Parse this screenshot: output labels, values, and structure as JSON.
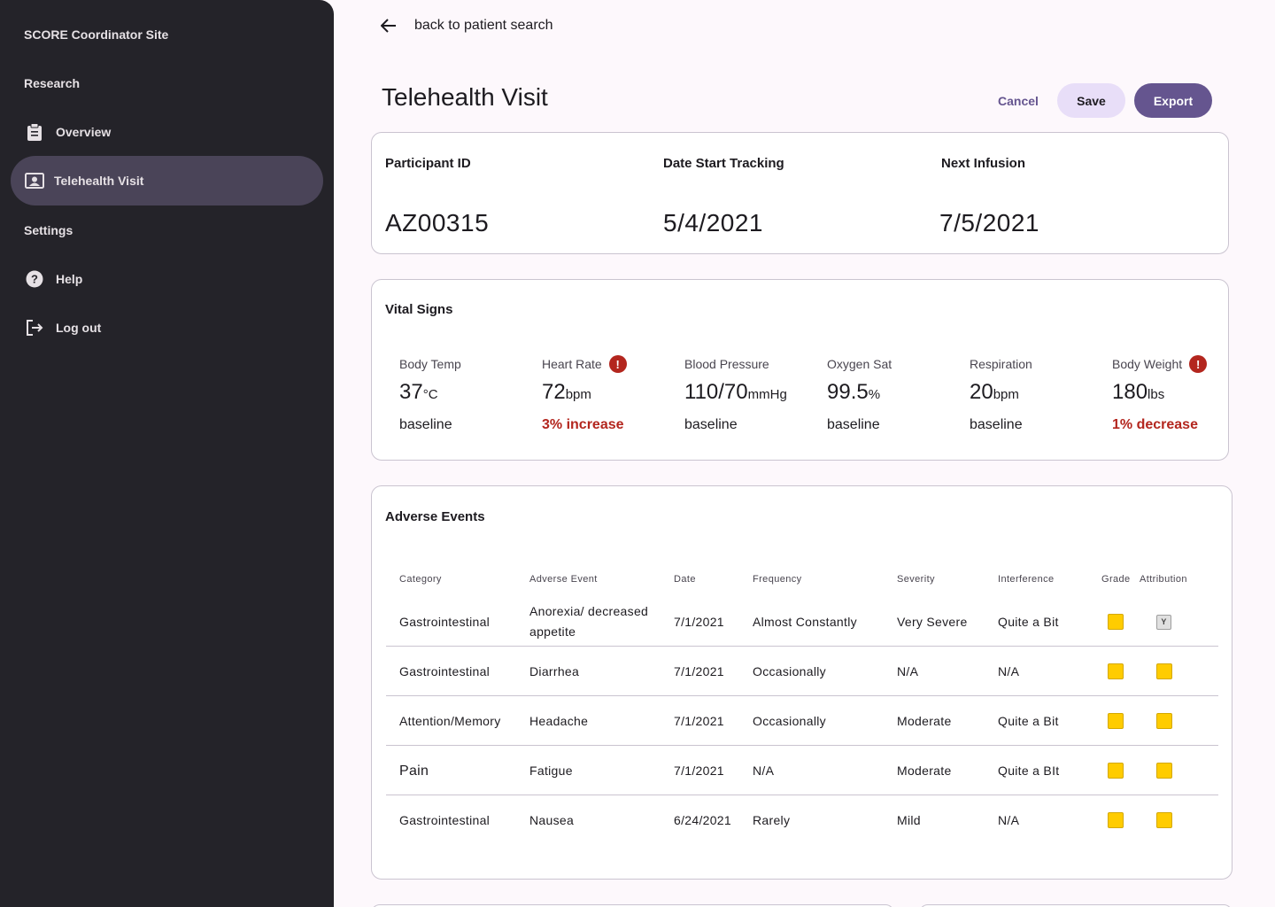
{
  "sidebar": {
    "site_title": "SCORE Coordinator Site",
    "section_research": "Research",
    "items": [
      {
        "label": "Overview",
        "icon": "clipboard-icon"
      },
      {
        "label": "Telehealth Visit",
        "icon": "video-portrait-icon"
      }
    ],
    "section_settings": "Settings",
    "settings_items": [
      {
        "label": "Help",
        "icon": "help-icon"
      },
      {
        "label": "Log out",
        "icon": "logout-icon"
      }
    ]
  },
  "header": {
    "back_label": "back to patient search",
    "title": "Telehealth Visit",
    "cancel_label": "Cancel",
    "save_label": "Save",
    "export_label": "Export"
  },
  "participant": {
    "id_label": "Participant ID",
    "id_value": "AZ00315",
    "start_label": "Date Start Tracking",
    "start_value": "5/4/2021",
    "infusion_label": "Next Infusion",
    "infusion_value": "7/5/2021"
  },
  "vitals": {
    "heading": "Vital Signs",
    "items": [
      {
        "label": "Body Temp",
        "value": "37",
        "unit": "°C",
        "status": "baseline",
        "alert": false
      },
      {
        "label": "Heart Rate",
        "value": "72",
        "unit": "bpm",
        "status": "3% increase",
        "alert": true
      },
      {
        "label": "Blood Pressure",
        "value": "110/70",
        "unit": "mmHg",
        "status": "baseline",
        "alert": false
      },
      {
        "label": "Oxygen Sat",
        "value": "99.5",
        "unit": "%",
        "status": "baseline",
        "alert": false
      },
      {
        "label": "Respiration",
        "value": "20",
        "unit": "bpm",
        "status": "baseline",
        "alert": false
      },
      {
        "label": "Body Weight",
        "value": "180",
        "unit": "lbs",
        "status": "1% decrease",
        "alert": true
      }
    ],
    "alert_glyph": "!"
  },
  "adverse_events": {
    "heading": "Adverse Events",
    "columns": [
      "Category",
      "Adverse Event",
      "Date",
      "Frequency",
      "Severity",
      "Interference",
      "Grade",
      "Attribution"
    ],
    "rows": [
      {
        "category": "Gastrointestinal",
        "event": "Anorexia/ decreased appetite",
        "date": "7/1/2021",
        "frequency": "Almost Constantly",
        "severity": "Very Severe",
        "interference": "Quite a Bit",
        "attribution_tag": "Y"
      },
      {
        "category": "Gastrointestinal",
        "event": "Diarrhea",
        "date": "7/1/2021",
        "frequency": "Occasionally",
        "severity": "N/A",
        "interference": "N/A"
      },
      {
        "category": "Attention/Memory",
        "event": "Headache",
        "date": "7/1/2021",
        "frequency": "Occasionally",
        "severity": "Moderate",
        "interference": "Quite a Bit"
      },
      {
        "category": "Pain",
        "event": "Fatigue",
        "date": "7/1/2021",
        "frequency": "N/A",
        "severity": "Moderate",
        "interference": "Quite a BIt"
      },
      {
        "category": "Gastrointestinal",
        "event": "Nausea",
        "date": "6/24/2021",
        "frequency": "Rarely",
        "severity": "Mild",
        "interference": "N/A"
      }
    ],
    "swatch_color": "#ffcc00"
  },
  "colors": {
    "sidebar_bg": "#242329",
    "active_item_bg": "#4a4458",
    "primary": "#65558f",
    "secondary_container": "#e8def8",
    "alert": "#b3261e",
    "page_bg": "#fdf8fc"
  }
}
